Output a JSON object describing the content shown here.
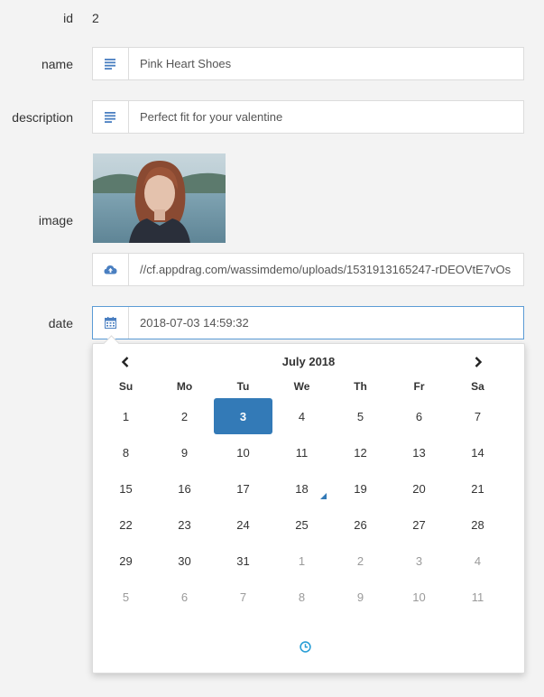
{
  "form": {
    "id_label": "id",
    "id_value": "2",
    "name_label": "name",
    "name_value": "Pink Heart Shoes",
    "description_label": "description",
    "description_value": "Perfect fit for your valentine",
    "image_label": "image",
    "image_url": "//cf.appdrag.com/wassimdemo/uploads/1531913165247-rDEOVtE7vOs",
    "date_label": "date",
    "date_value": "2018-07-03 14:59:32"
  },
  "datepicker": {
    "month_title": "July 2018",
    "weekdays": [
      "Su",
      "Mo",
      "Tu",
      "We",
      "Th",
      "Fr",
      "Sa"
    ],
    "weeks": [
      [
        "1",
        "2",
        "3",
        "4",
        "5",
        "6",
        "7"
      ],
      [
        "8",
        "9",
        "10",
        "11",
        "12",
        "13",
        "14"
      ],
      [
        "15",
        "16",
        "17",
        "18",
        "19",
        "20",
        "21"
      ],
      [
        "22",
        "23",
        "24",
        "25",
        "26",
        "27",
        "28"
      ],
      [
        "29",
        "30",
        "31",
        "1",
        "2",
        "3",
        "4"
      ],
      [
        "5",
        "6",
        "7",
        "8",
        "9",
        "10",
        "11"
      ]
    ],
    "selected_day": "3",
    "today_day": "18"
  },
  "colors": {
    "accent": "#337ab7",
    "icon_blue": "#4a7fc1",
    "focus_border": "#5b9bd5"
  },
  "icons": {
    "text_field": "align-left-icon",
    "upload": "cloud-upload-icon",
    "calendar": "calendar-icon",
    "prev": "chevron-left-icon",
    "next": "chevron-right-icon",
    "time": "clock-icon"
  }
}
